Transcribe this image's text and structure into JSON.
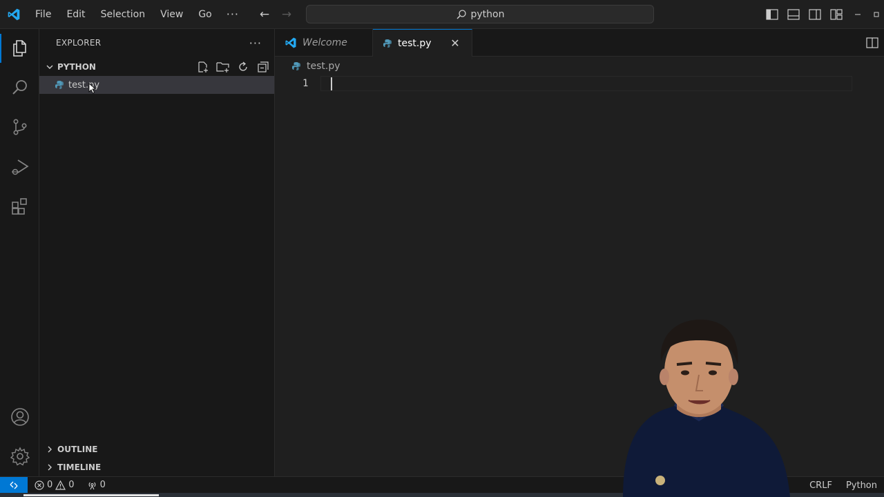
{
  "titlebar": {
    "menu": [
      "File",
      "Edit",
      "Selection",
      "View",
      "Go"
    ],
    "more": "···",
    "search_text": "python",
    "back_arrow": "←",
    "forward_arrow": "→"
  },
  "activity_bar": {
    "items": [
      "explorer",
      "search",
      "source-control",
      "run-and-debug",
      "extensions"
    ],
    "bottom": [
      "accounts",
      "manage"
    ]
  },
  "sidebar": {
    "title": "EXPLORER",
    "more": "···",
    "folder": "PYTHON",
    "files": [
      "test.py"
    ],
    "panels": [
      "OUTLINE",
      "TIMELINE"
    ]
  },
  "editor": {
    "tabs": [
      {
        "label": "Welcome",
        "italic": true
      },
      {
        "label": "test.py",
        "active": true,
        "close": "✕"
      }
    ],
    "breadcrumb": "test.py",
    "lines": [
      "1"
    ]
  },
  "statusbar": {
    "errors": "0",
    "warnings": "0",
    "ports": "0",
    "eol": "CRLF",
    "language": "Python"
  },
  "colors": {
    "accent": "#0078d4",
    "python_file": "#519aba"
  }
}
